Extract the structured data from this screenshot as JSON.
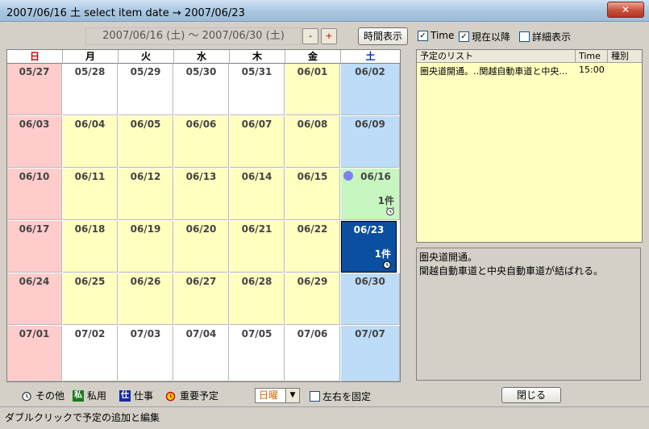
{
  "window": {
    "title": "2007/06/16 土  select item date → 2007/06/23",
    "close": "✕"
  },
  "toolbar": {
    "range": "2007/06/16 (土) 〜 2007/06/30 (土)",
    "minus": "-",
    "plus": "+",
    "time_view": "時間表示",
    "time_chk": "Time",
    "after_now_chk": "現在以降",
    "detail_chk": "詳細表示"
  },
  "calendar": {
    "headers": [
      "日",
      "月",
      "火",
      "水",
      "木",
      "金",
      "土"
    ],
    "weeks": [
      [
        "05/27",
        "05/28",
        "05/29",
        "05/30",
        "05/31",
        "06/01",
        "06/02"
      ],
      [
        "06/03",
        "06/04",
        "06/05",
        "06/06",
        "06/07",
        "06/08",
        "06/09"
      ],
      [
        "06/10",
        "06/11",
        "06/12",
        "06/13",
        "06/14",
        "06/15",
        "06/16"
      ],
      [
        "06/17",
        "06/18",
        "06/19",
        "06/20",
        "06/21",
        "06/22",
        "06/23"
      ],
      [
        "06/24",
        "06/25",
        "06/26",
        "06/27",
        "06/28",
        "06/29",
        "06/30"
      ],
      [
        "07/01",
        "07/02",
        "07/03",
        "07/04",
        "07/05",
        "07/06",
        "07/07"
      ]
    ],
    "count_0616": "1件",
    "count_0623": "1件"
  },
  "list": {
    "headers": [
      "予定のリスト",
      "Time",
      "種別"
    ],
    "rows": [
      {
        "title": "圏央道開通。‥関越自動車道と中央...",
        "time": "15:00",
        "kind": ""
      }
    ]
  },
  "detail": {
    "line1": "圏央道開通。",
    "line2": "関越自動車道と中央自動車道が結ばれる。"
  },
  "legend": {
    "other": "その他",
    "private": "私用",
    "work": "仕事",
    "important": "重要予定",
    "private_mark": "私",
    "work_mark": "仕"
  },
  "week_start": {
    "value": "日曜"
  },
  "fix_lr": "左右を固定",
  "close_btn": "閉じる",
  "status": "ダブルクリックで予定の追加と編集",
  "colors": {
    "sunday": "#ffcccc",
    "saturday": "#bddcf8",
    "weekday": "#ffffc0",
    "selected": "#0a4fa0",
    "today": "#c8f6c0"
  }
}
